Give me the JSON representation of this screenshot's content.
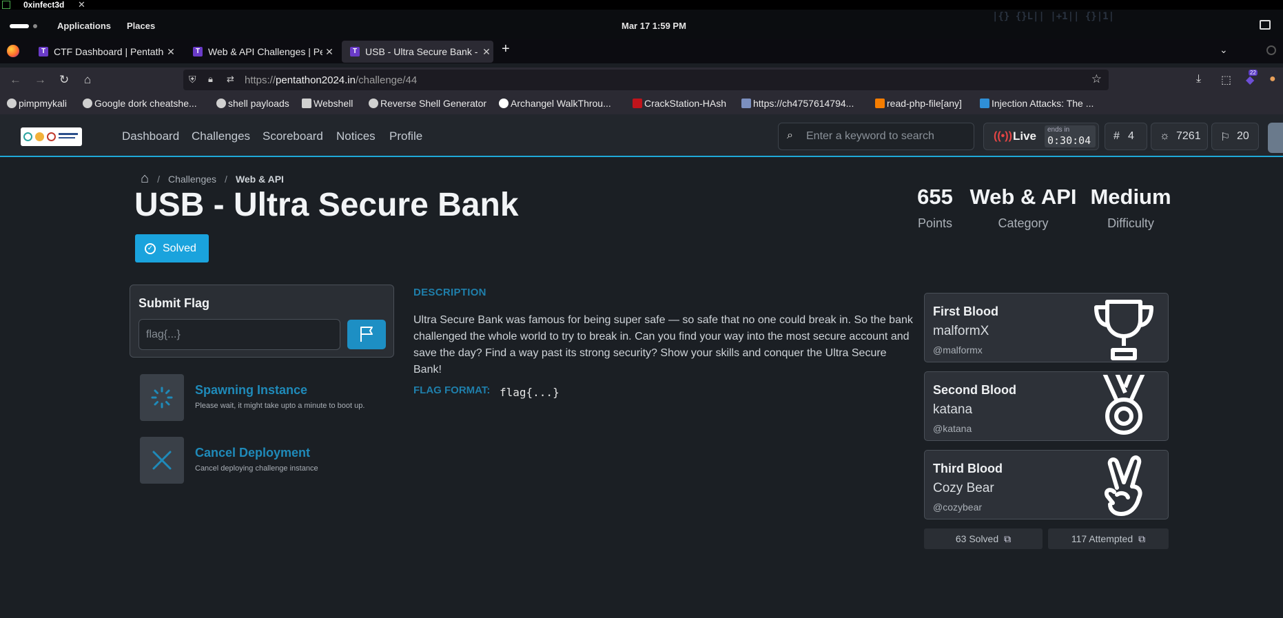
{
  "os": {
    "window_title": "0xinfect3d",
    "menu_applications": "Applications",
    "menu_places": "Places",
    "clock": "Mar 17    1:59 PM"
  },
  "browser": {
    "tabs": [
      {
        "label": "CTF Dashboard | Pentathon",
        "active": false
      },
      {
        "label": "Web & API Challenges | Pentathon",
        "active": false
      },
      {
        "label": "USB - Ultra Secure Bank - Pentathon",
        "active": true
      }
    ],
    "url_prefix": "https://",
    "url_host": "pentathon2024.in",
    "url_path": "/challenge/44",
    "extension_badge": "22",
    "bookmarks": [
      {
        "label": "pimpmykali",
        "icon": "github-icon"
      },
      {
        "label": "Google dork cheatshe...",
        "icon": "github-icon"
      },
      {
        "label": "shell payloads",
        "icon": "github-icon"
      },
      {
        "label": "Webshell",
        "icon": "page-icon"
      },
      {
        "label": "Reverse Shell Generator",
        "icon": "skull-icon"
      },
      {
        "label": "Archangel WalkThrou...",
        "icon": "medium-icon"
      },
      {
        "label": "CrackStation-HAsh",
        "icon": "crackstation-icon"
      },
      {
        "label": "https://ch4757614794...",
        "icon": "robot-icon"
      },
      {
        "label": "read-php-file[any]",
        "icon": "blogger-icon"
      },
      {
        "label": "Injection Attacks: The ...",
        "icon": "site-icon"
      }
    ]
  },
  "site": {
    "nav": [
      "Dashboard",
      "Challenges",
      "Scoreboard",
      "Notices",
      "Profile"
    ],
    "search_placeholder": "Enter a keyword to search",
    "live_label": "Live",
    "ends_in_label": "ends in",
    "timer": "0:30:04",
    "rank": "4",
    "score": "7261",
    "solves": "20"
  },
  "challenge": {
    "breadcrumb": [
      "Challenges",
      "Web & API"
    ],
    "title": "USB - Ultra Secure Bank",
    "status": "Solved",
    "points": "655",
    "points_label": "Points",
    "category": "Web & API",
    "category_label": "Category",
    "difficulty": "Medium",
    "difficulty_label": "Difficulty",
    "submit_heading": "Submit Flag",
    "flag_placeholder": "flag{...}",
    "spawn_title": "Spawning Instance",
    "spawn_sub": "Please wait, it might take upto a minute to boot up.",
    "cancel_title": "Cancel Deployment",
    "cancel_sub": "Cancel deploying challenge instance",
    "description_heading": "DESCRIPTION",
    "description": "Ultra Secure Bank was famous for being super safe — so safe that no one could break in. So the bank challenged the whole world to try to break in. Can you find your way into the most secure account and save the day? Find a way past its strong security? Show your skills and conquer the Ultra Secure Bank!",
    "flag_format_label": "FLAG FORMAT:",
    "flag_format": "flag{...}",
    "bloods": [
      {
        "title": "First Blood",
        "name": "malformX",
        "handle": "@malformx",
        "icon": "trophy-icon"
      },
      {
        "title": "Second Blood",
        "name": "katana",
        "handle": "@katana",
        "icon": "medal-icon"
      },
      {
        "title": "Third Blood",
        "name": "Cozy Bear",
        "handle": "@cozybear",
        "icon": "peace-hand-icon"
      }
    ],
    "solved_count": "63 Solved",
    "attempted_count": "117 Attempted"
  },
  "colors": {
    "accent": "#1aa3dd",
    "background": "#1b1f24",
    "live": "#e64545"
  }
}
